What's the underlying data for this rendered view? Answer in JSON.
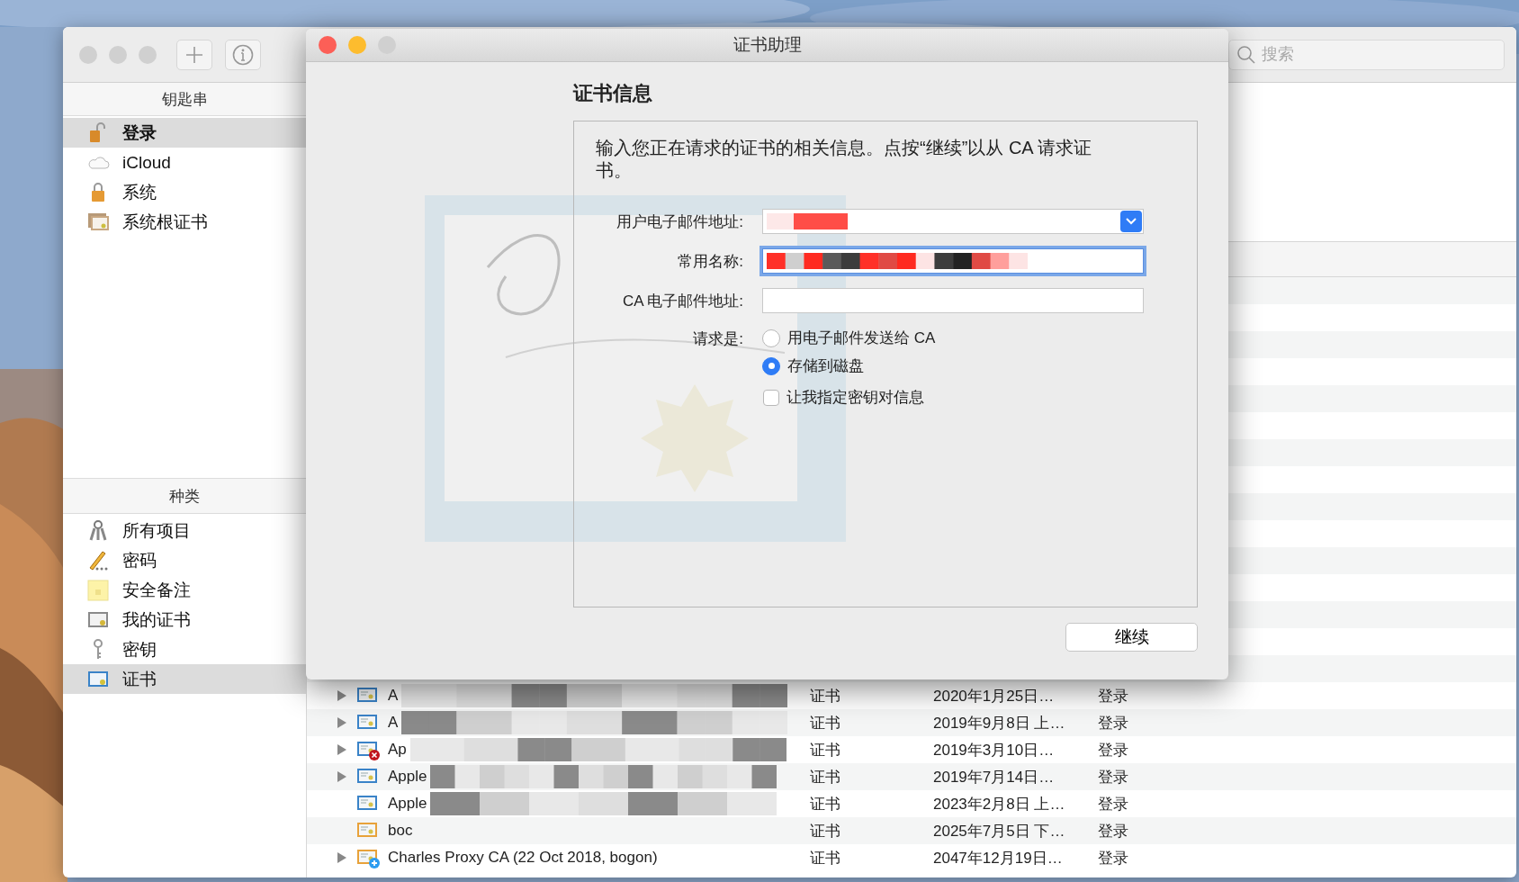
{
  "keychain_window": {
    "toolbar": {
      "search": {
        "placeholder": "搜索"
      }
    },
    "sidebar": {
      "keychains_header": "钥匙串",
      "keychains": [
        {
          "label": "登录",
          "selected": true
        },
        {
          "label": "iCloud",
          "selected": false
        },
        {
          "label": "系统",
          "selected": false
        },
        {
          "label": "系统根证书",
          "selected": false
        }
      ],
      "categories_header": "种类",
      "categories": [
        {
          "label": "所有项目",
          "selected": false
        },
        {
          "label": "密码",
          "selected": false
        },
        {
          "label": "安全备注",
          "selected": false
        },
        {
          "label": "我的证书",
          "selected": false
        },
        {
          "label": "密钥",
          "selected": false
        },
        {
          "label": "证书",
          "selected": true
        }
      ]
    },
    "list": {
      "rows": [
        {
          "name": "A",
          "kind": "证书",
          "date": "2020年1月25日…",
          "keychain": "登录",
          "expandable": true,
          "redacted": true
        },
        {
          "name": "A",
          "kind": "证书",
          "date": "2019年9月8日 上…",
          "keychain": "登录",
          "expandable": true,
          "redacted": true
        },
        {
          "name": "Ap",
          "kind": "证书",
          "date": "2019年3月10日…",
          "keychain": "登录",
          "expandable": true,
          "redacted": true
        },
        {
          "name": "Apple",
          "kind": "证书",
          "date": "2019年7月14日…",
          "keychain": "登录",
          "expandable": true,
          "redacted": true
        },
        {
          "name": "Apple",
          "kind": "证书",
          "date": "2023年2月8日 上…",
          "keychain": "登录",
          "expandable": false,
          "redacted": true
        },
        {
          "name": "boc",
          "kind": "证书",
          "date": "2025年7月5日 下…",
          "keychain": "登录",
          "expandable": false,
          "redacted": false
        },
        {
          "name": "Charles Proxy CA (22 Oct 2018, bogon)",
          "kind": "证书",
          "date": "2047年12月19日…",
          "keychain": "登录",
          "expandable": true,
          "redacted": false
        }
      ]
    }
  },
  "dialog": {
    "title": "证书助理",
    "heading": "证书信息",
    "intro": "输入您正在请求的证书的相关信息。点按“继续”以从 CA 请求证书。",
    "fields": [
      {
        "label": "用户电子邮件地址:",
        "kind": "combo",
        "redacted": true,
        "focused": false
      },
      {
        "label": "常用名称:",
        "kind": "text",
        "redacted": true,
        "focused": true
      },
      {
        "label": "CA 电子邮件地址:",
        "kind": "text",
        "redacted": false,
        "focused": false
      }
    ],
    "request_label": "请求是:",
    "request_options": [
      {
        "label": "用电子邮件发送给 CA",
        "selected": false
      },
      {
        "label": "存储到磁盘",
        "selected": true
      }
    ],
    "checkbox": {
      "label": "让我指定密钥对信息",
      "checked": false
    },
    "continue_button": "继续"
  }
}
